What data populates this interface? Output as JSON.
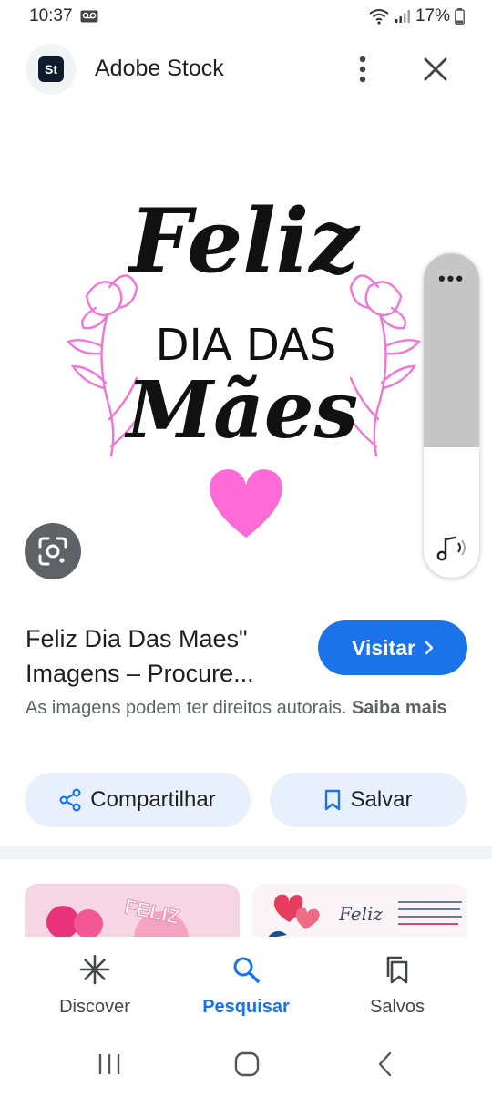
{
  "status_bar": {
    "time": "10:37",
    "battery": "17%",
    "icons": [
      "voicemail-icon",
      "wifi-icon",
      "signal-icon",
      "battery-icon"
    ]
  },
  "header": {
    "app_logo_text": "St",
    "title": "Adobe Stock",
    "menu_icon": "more-vertical-icon",
    "close_icon": "close-icon"
  },
  "image": {
    "text_line1": "Feliz",
    "text_line2": "DIA DAS",
    "text_line3": "Mães",
    "accent_color": "#ff66cc",
    "ink_color": "#111111"
  },
  "side_panel": {
    "menu_label": "•••",
    "icon": "music-note-icon"
  },
  "result": {
    "title": "Feliz Dia Das Maes\" Imagens – Procure...",
    "visit_label": "Visitar",
    "copyright_text": "As imagens podem ter direitos autorais.",
    "learn_more": "Saiba mais"
  },
  "actions": {
    "share_label": "Compartilhar",
    "save_label": "Salvar"
  },
  "related": {
    "thumb1_text": "FELIZ",
    "thumb2_text": "Feliz"
  },
  "bottom_nav": {
    "items": [
      {
        "label": "Discover",
        "icon": "discover-icon"
      },
      {
        "label": "Pesquisar",
        "icon": "search-icon"
      },
      {
        "label": "Salvos",
        "icon": "saved-icon"
      }
    ],
    "active": "Pesquisar",
    "active_color": "#1a73e8"
  },
  "colors": {
    "primary": "#1a73e8",
    "chip_bg": "#e8f0fe"
  }
}
